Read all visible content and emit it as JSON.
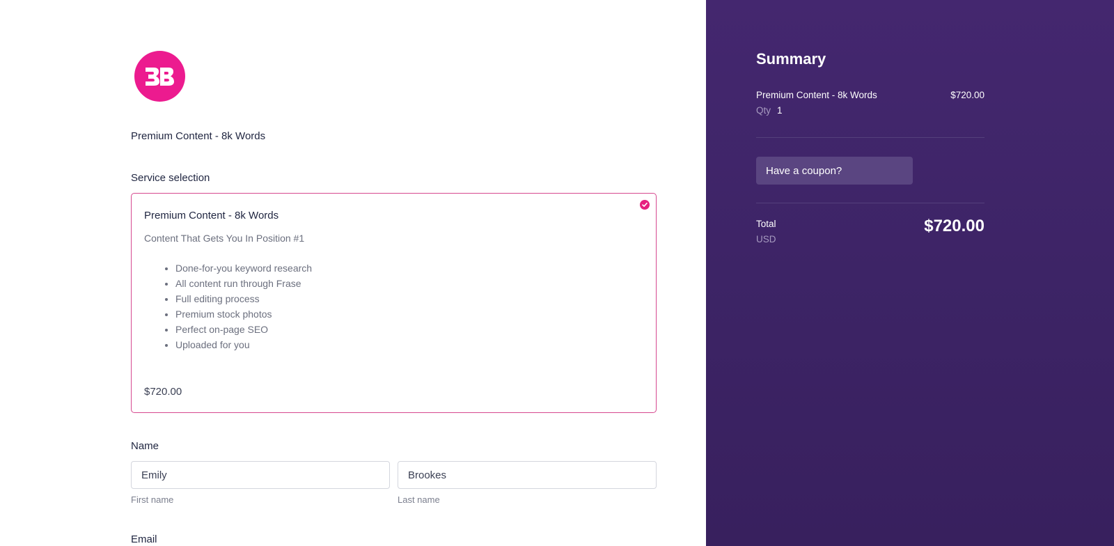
{
  "colors": {
    "brand_pink": "#ec1b8f",
    "card_border": "#d6488f",
    "sidebar_purple": "#3d2466"
  },
  "logo": {
    "icon": "brand-logo-icon"
  },
  "product": {
    "title": "Premium Content - 8k Words"
  },
  "service": {
    "section_label": "Service selection",
    "card": {
      "title": "Premium Content - 8k Words",
      "subtitle": "Content That Gets You In Position #1",
      "features": [
        "Done-for-you keyword research",
        "All content run through Frase",
        "Full editing process",
        "Premium stock photos",
        "Perfect on-page SEO",
        "Uploaded for you"
      ],
      "price": "$720.00",
      "selected_icon": "check-circle-icon"
    }
  },
  "name": {
    "section_label": "Name",
    "first_value": "Emily",
    "last_value": "Brookes",
    "first_hint": "First name",
    "last_hint": "Last name"
  },
  "email": {
    "section_label": "Email"
  },
  "summary": {
    "title": "Summary",
    "item_name": "Premium Content - 8k Words",
    "item_price": "$720.00",
    "qty_label": "Qty",
    "qty_value": "1",
    "coupon_label": "Have a coupon?",
    "total_label": "Total",
    "currency": "USD",
    "total_amount": "$720.00"
  }
}
